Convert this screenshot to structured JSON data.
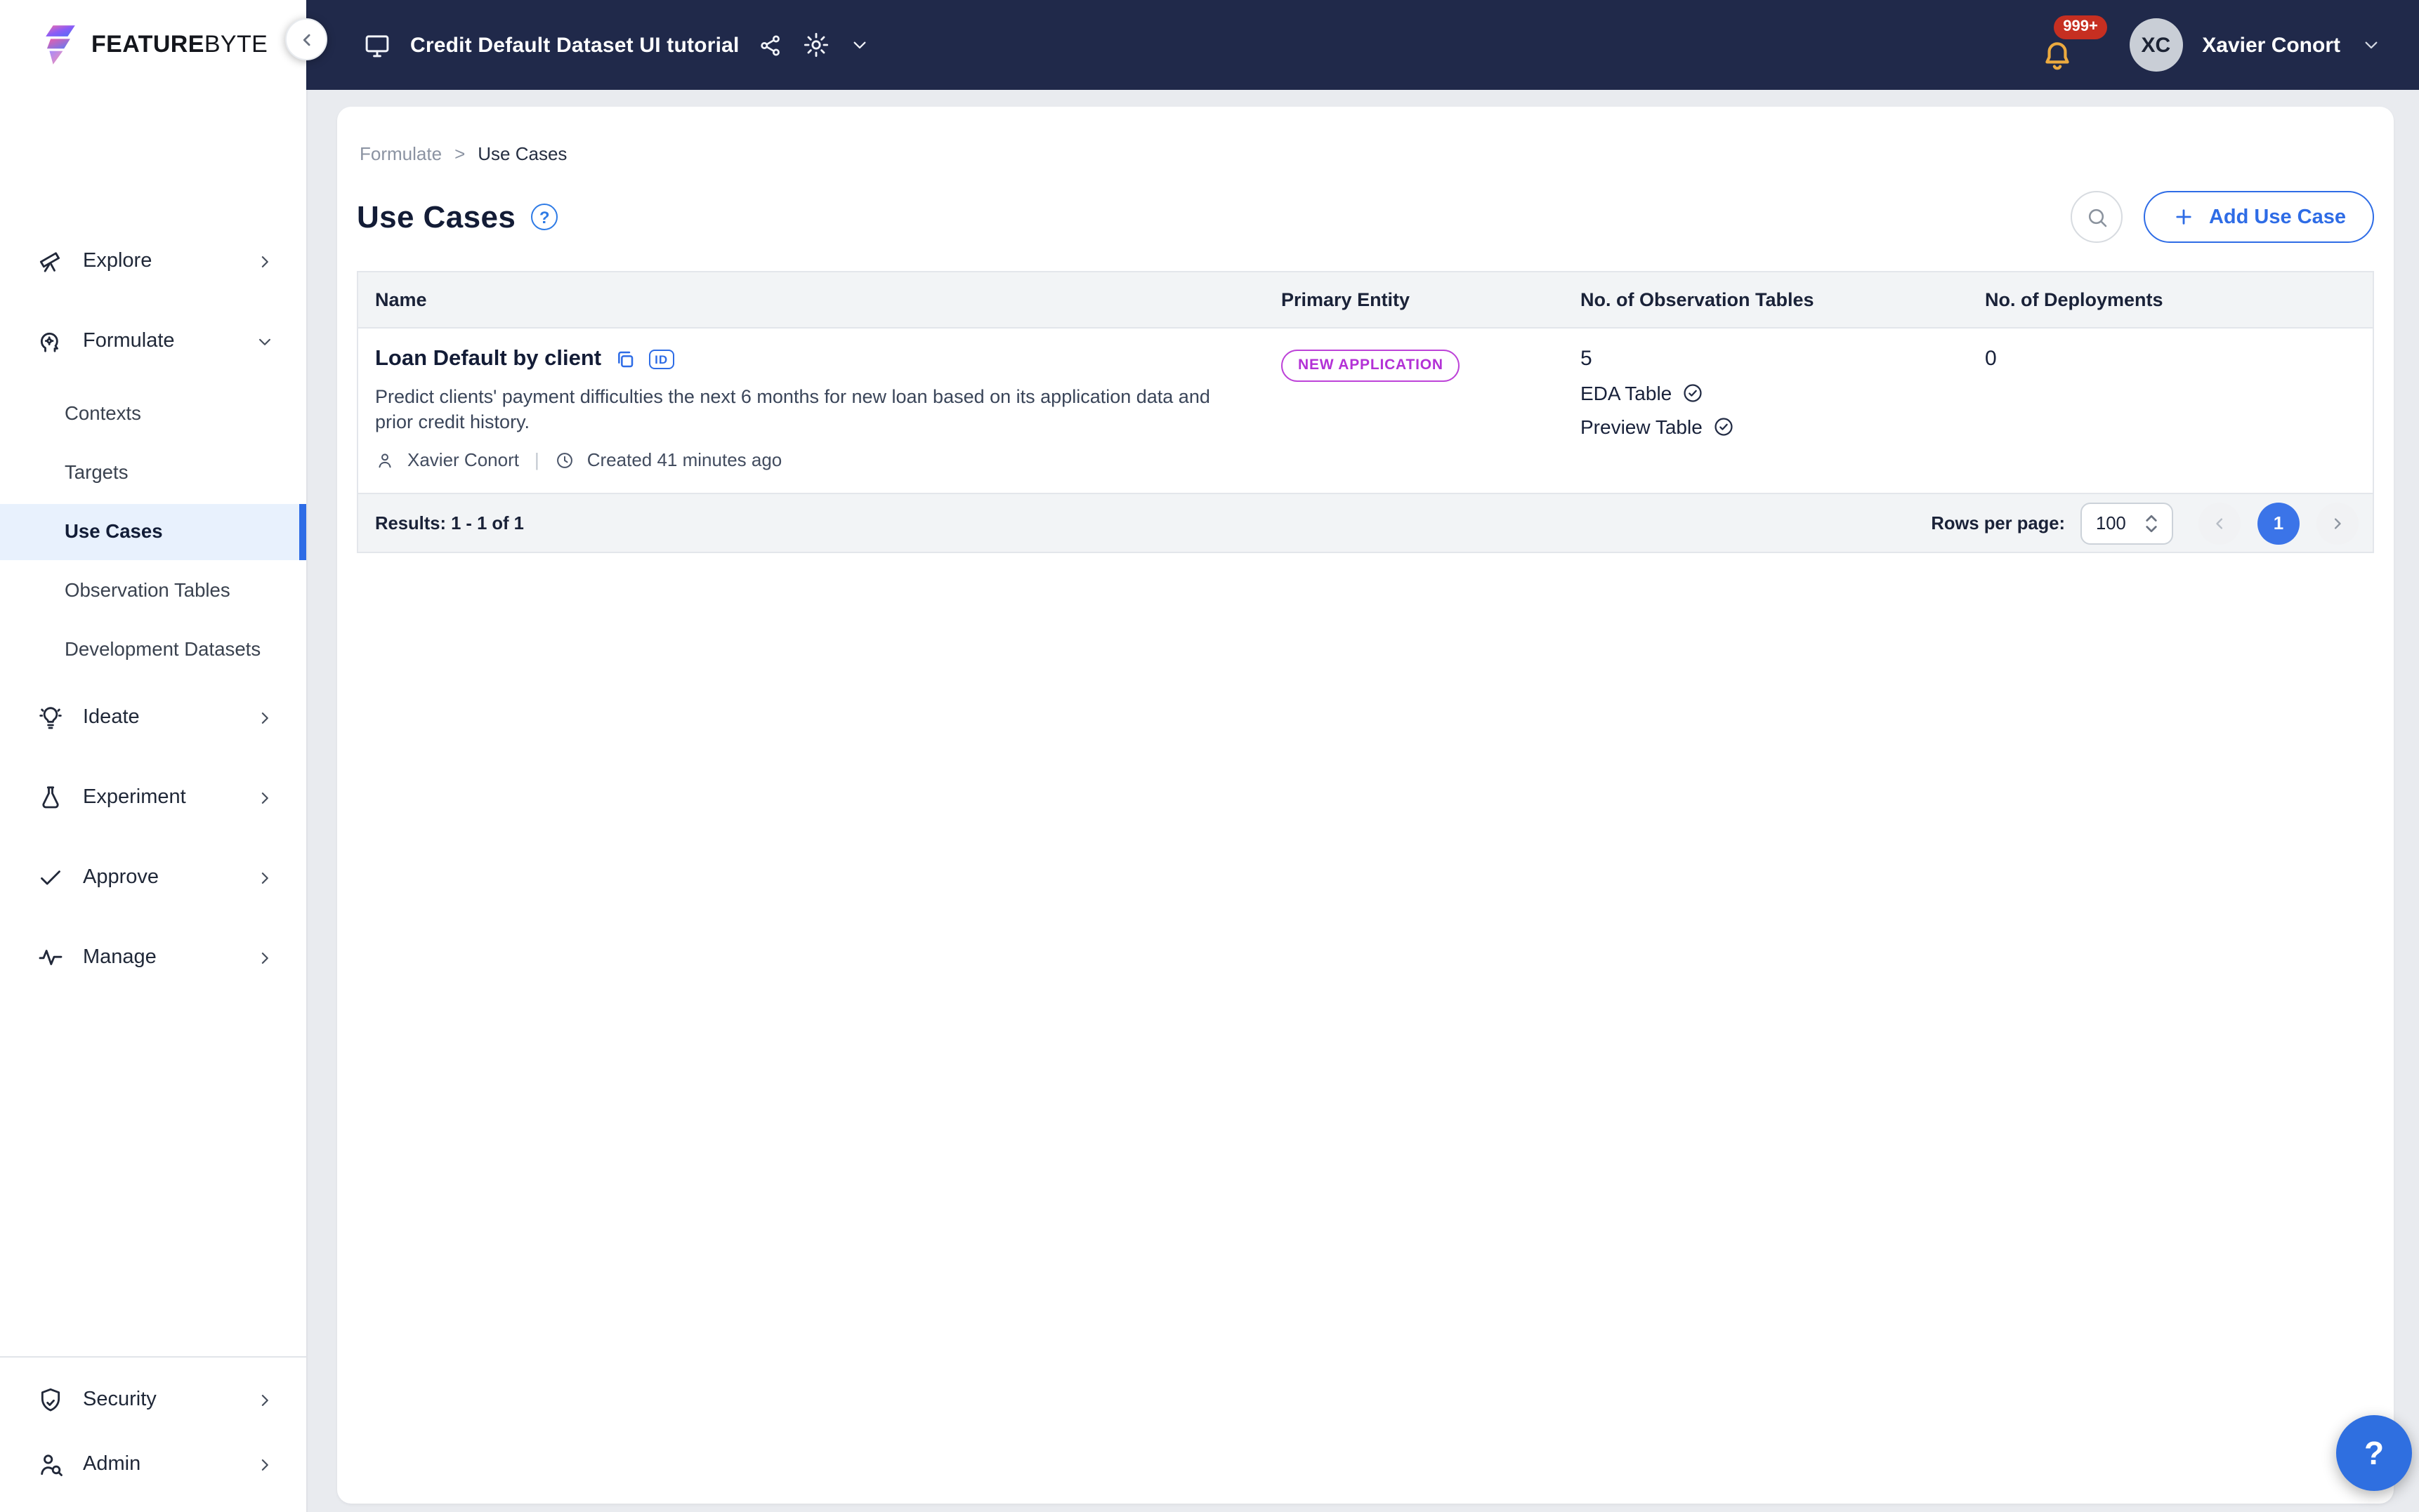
{
  "colors": {
    "topbar_bg": "#20294a",
    "accent_blue": "#2e6ce6",
    "page_number_blue": "#3b74e8",
    "active_item_bg": "#e8f1fd",
    "badge_purple": "#b331d6",
    "notification_red": "#c62f21",
    "bell_yellow": "#ecaa3f",
    "page_bg": "#e9ebef",
    "dark_text": "#131c36"
  },
  "logo": {
    "brand_bold": "FEATURE",
    "brand_light": "BYTE"
  },
  "topbar": {
    "project_label": "Credit Default Dataset UI tutorial",
    "notifications_badge": "999+",
    "user_initials": "XC",
    "user_name": "Xavier Conort"
  },
  "icons": {
    "id_chip": "ID",
    "breadcrumb_separator": ">",
    "help_glyph": "?"
  },
  "sidebar": {
    "items": [
      {
        "label": "Explore",
        "icon": "telescope-icon"
      },
      {
        "label": "Formulate",
        "icon": "head-gear-icon",
        "expanded": true,
        "children": [
          "Contexts",
          "Targets",
          "Use Cases",
          "Observation Tables",
          "Development Datasets"
        ],
        "active_child": "Use Cases"
      },
      {
        "label": "Ideate",
        "icon": "lightbulb-icon"
      },
      {
        "label": "Experiment",
        "icon": "flask-icon"
      },
      {
        "label": "Approve",
        "icon": "check-icon"
      },
      {
        "label": "Manage",
        "icon": "activity-icon"
      }
    ],
    "bottom": [
      {
        "label": "Security",
        "icon": "shield-check-icon"
      },
      {
        "label": "Admin",
        "icon": "user-search-icon"
      }
    ]
  },
  "breadcrumb": {
    "parent": "Formulate",
    "separator": ">",
    "current": "Use Cases"
  },
  "page": {
    "title": "Use Cases"
  },
  "actions": {
    "add_label": "Add Use Case"
  },
  "table": {
    "columns": [
      "Name",
      "Primary Entity",
      "No. of Observation Tables",
      "No. of Deployments"
    ],
    "rows": [
      {
        "name": "Loan Default by client",
        "description": "Predict clients' payment difficulties the next 6 months for new loan based on its application data and prior credit history.",
        "author": "Xavier Conort",
        "created": "Created 41 minutes ago",
        "primary_entity": "NEW APPLICATION",
        "observation_tables_count": "5",
        "observation_tables": [
          {
            "label": "EDA Table"
          },
          {
            "label": "Preview Table"
          }
        ],
        "deployments": "0"
      }
    ],
    "footer": {
      "results": "Results: 1 - 1 of 1",
      "rows_per_page_label": "Rows per page:",
      "rows_per_page_value": "100",
      "current_page": "1"
    }
  },
  "help": {
    "label": "?"
  }
}
